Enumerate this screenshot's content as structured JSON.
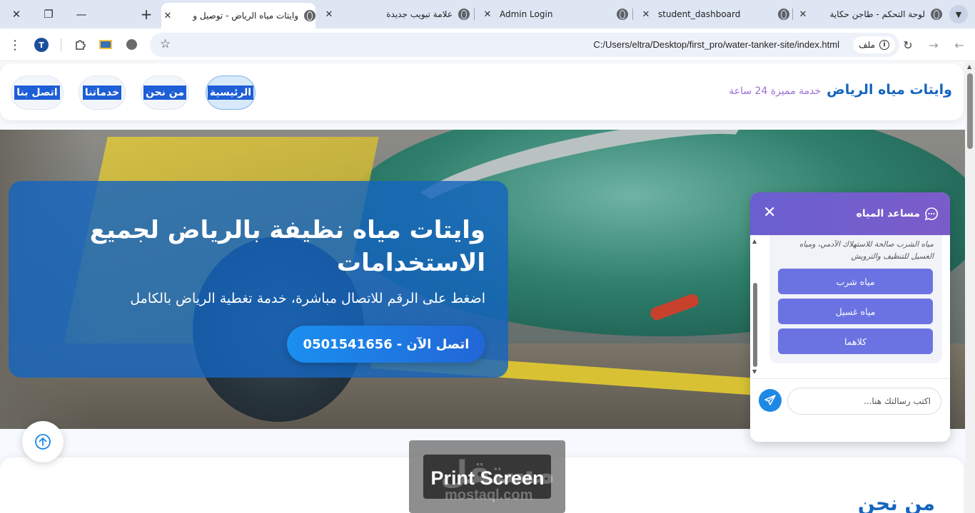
{
  "browser": {
    "tabs": [
      {
        "title": "وايتات مياه الرياض - توصيل و",
        "active": true
      },
      {
        "title": "علامة تبويب جديدة",
        "active": false
      },
      {
        "title": "Admin Login",
        "active": false
      },
      {
        "title": "student_dashboard",
        "active": false
      },
      {
        "title": "لوحة التحكم - طاجن حكاية",
        "active": false
      }
    ],
    "close_glyph": "✕",
    "new_tab_glyph": "+",
    "url": "C:/Users/eltra/Desktop/first_pro/water-tanker-site/index.html",
    "file_chip_label": "ملف",
    "profile_initial": "T"
  },
  "site": {
    "brand_title": "وايتات مياه الرياض",
    "brand_tagline": "خدمة مميزة 24 ساعة",
    "nav": {
      "home": "الرئيسية",
      "about": "من نحن",
      "services": "خدماتنا",
      "contact": "اتصل بنا"
    },
    "hero": {
      "title": "وايتات مياه نظيفة بالرياض لجميع الاستخدامات",
      "subtitle": "اضغط على الرقم للاتصال مباشرة، خدمة تغطية الرياض بالكامل",
      "call_label": "اتصل الآن -",
      "phone": "0501541656"
    },
    "about_heading": "من نحن"
  },
  "chat": {
    "title": "مساعد المياه",
    "message": "مياه الشرب صالحة للاستهلاك الآدمي، ومياه الغسيل للتنظيف والترويش",
    "options": [
      "مياه شرب",
      "مياه غسيل",
      "كلاهما"
    ],
    "input_placeholder": "اكتب رسالتك هنا..."
  },
  "watermark": {
    "text": "Print Screen",
    "brand_arabic": "مستقل",
    "brand_site": "mostaql.com"
  },
  "colors": {
    "brand_blue": "#1565c0",
    "tagline_purple": "#9b6fd3",
    "chat_header": "#6a5fd0",
    "chat_option": "#6b73e3",
    "send_button": "#1e88e5"
  }
}
